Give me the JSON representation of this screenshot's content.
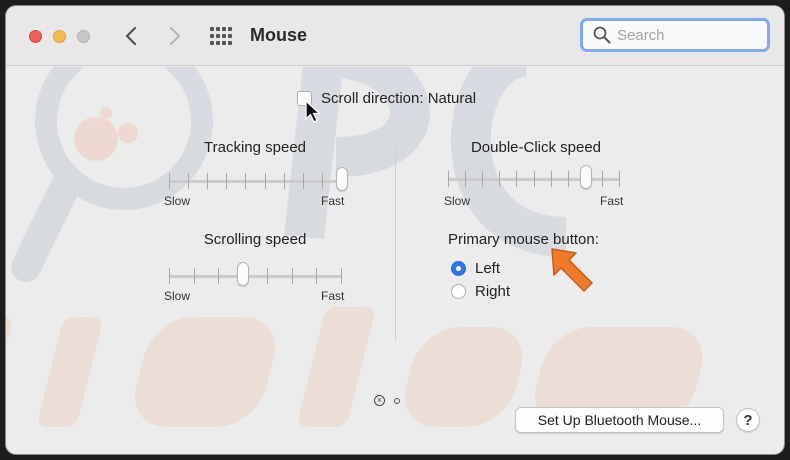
{
  "window": {
    "title": "Mouse",
    "search_placeholder": "Search"
  },
  "options": {
    "scroll_direction_label": "Scroll direction: Natural",
    "scroll_direction_checked": false
  },
  "tracking": {
    "title": "Tracking speed",
    "min_label": "Slow",
    "max_label": "Fast",
    "value_fraction": 1.0,
    "ticks": 10
  },
  "scrolling": {
    "title": "Scrolling speed",
    "min_label": "Slow",
    "max_label": "Fast",
    "value_fraction": 0.43,
    "ticks": 8
  },
  "double_click": {
    "title": "Double-Click speed",
    "min_label": "Slow",
    "max_label": "Fast",
    "value_fraction": 0.8,
    "ticks": 11
  },
  "primary_button": {
    "title": "Primary mouse button:",
    "options": [
      {
        "label": "Left",
        "selected": true
      },
      {
        "label": "Right",
        "selected": false
      }
    ]
  },
  "footer": {
    "bluetooth_button": "Set Up Bluetooth Mouse...",
    "help_button": "?"
  },
  "colors": {
    "accent": "#2f74f0",
    "arrow_annotation": "#ee7a2a"
  }
}
